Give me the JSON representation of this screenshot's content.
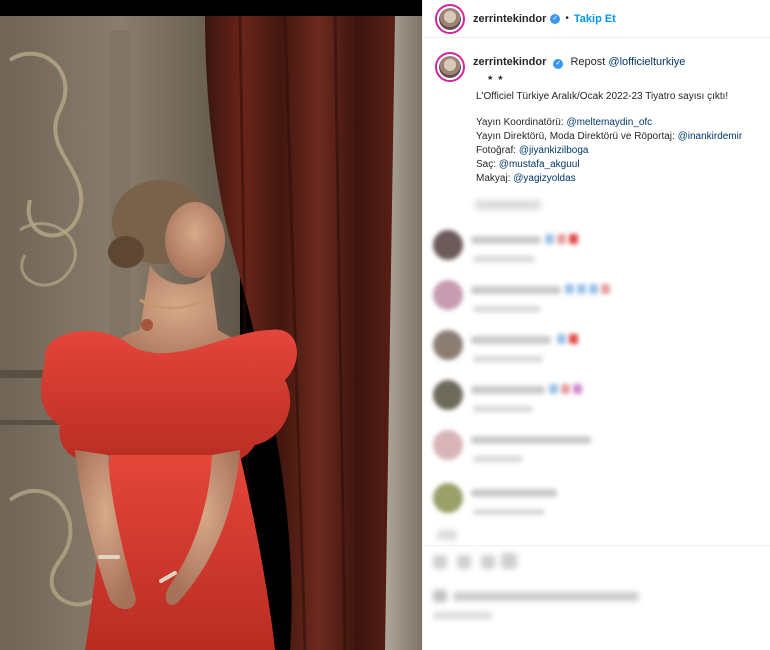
{
  "header": {
    "username": "zerrintekindor",
    "separator": "•",
    "follow_label": "Takip Et"
  },
  "caption": {
    "username": "zerrintekindor",
    "repost_label": "Repost",
    "repost_handle": "@lofficielturkiye",
    "stars": "★ ★",
    "headline": "L'Officiel Türkiye Aralık/Ocak 2022-23 Tiyatro sayısı çıktı!",
    "credits": [
      {
        "label": "Yayın Koordinatörü:",
        "handle": "@meltemaydin_ofc"
      },
      {
        "label": "Yayın Direktörü, Moda Direktörü ve Röportaj:",
        "handle": "@inankirdemir"
      },
      {
        "label": "Fotoğraf:",
        "handle": "@jiyankizilboga"
      },
      {
        "label": "Saç:",
        "handle": "@mustafa_akguul"
      },
      {
        "label": "Makyaj:",
        "handle": "@yagizyoldas"
      }
    ]
  },
  "colors": {
    "follow_blue": "#0095f6",
    "mention_blue": "#00376b",
    "verified_blue": "#3897f0",
    "dress_red": "#d63a2c",
    "curtain_red": "#5a1d14"
  },
  "icons": {
    "verified": "verified-badge-icon"
  }
}
